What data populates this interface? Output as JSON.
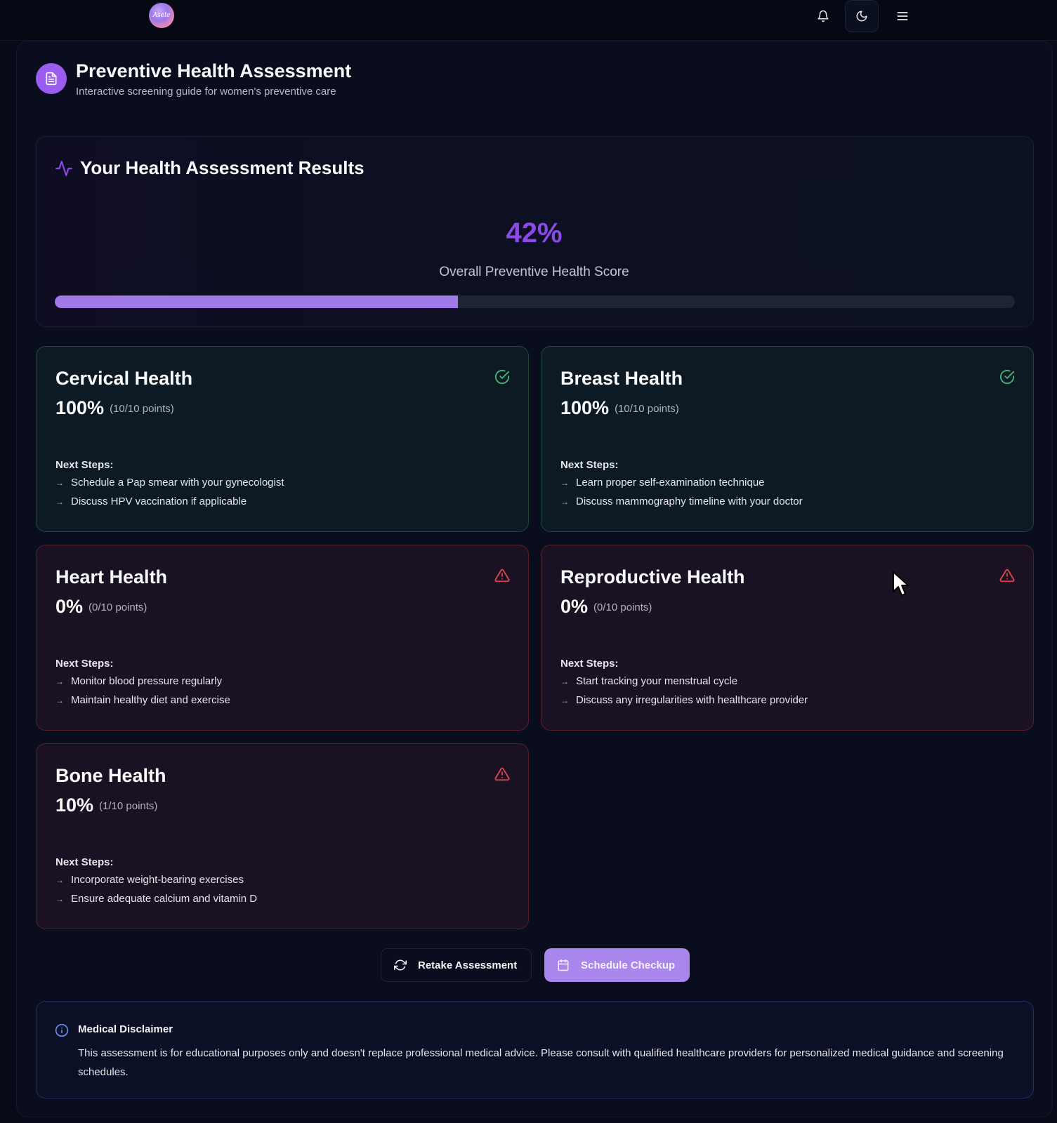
{
  "topbar": {
    "logo_text": "Asele",
    "icons": [
      "bell-icon",
      "moon-icon",
      "menu-icon"
    ]
  },
  "header": {
    "title": "Preventive Health Assessment",
    "subtitle": "Interactive screening guide for women's preventive care",
    "icon": "document-icon"
  },
  "results": {
    "title": "Your Health Assessment Results",
    "icon": "activity-icon",
    "score_text": "42%",
    "score_value": 42,
    "score_label": "Overall Preventive Health Score"
  },
  "next_steps_label": "Next Steps:",
  "categories": [
    {
      "name": "Cervical Health",
      "score": "100%",
      "points": "(10/10 points)",
      "status": "good",
      "steps": [
        "Schedule a Pap smear with your gynecologist",
        "Discuss HPV vaccination if applicable"
      ]
    },
    {
      "name": "Breast Health",
      "score": "100%",
      "points": "(10/10 points)",
      "status": "good",
      "steps": [
        "Learn proper self-examination technique",
        "Discuss mammography timeline with your doctor"
      ]
    },
    {
      "name": "Heart Health",
      "score": "0%",
      "points": "(0/10 points)",
      "status": "warning",
      "steps": [
        "Monitor blood pressure regularly",
        "Maintain healthy diet and exercise"
      ]
    },
    {
      "name": "Reproductive Health",
      "score": "0%",
      "points": "(0/10 points)",
      "status": "warning",
      "steps": [
        "Start tracking your menstrual cycle",
        "Discuss any irregularities with healthcare provider"
      ]
    },
    {
      "name": "Bone Health",
      "score": "10%",
      "points": "(1/10 points)",
      "status": "warning",
      "steps": [
        "Incorporate weight-bearing exercises",
        "Ensure adequate calcium and vitamin D"
      ]
    }
  ],
  "actions": {
    "retake_label": "Retake Assessment",
    "schedule_label": "Schedule Checkup"
  },
  "disclaimer": {
    "title": "Medical Disclaimer",
    "text": "This assessment is for educational purposes only and doesn't replace professional medical advice. Please consult with qualified healthcare providers for personalized medical guidance and screening schedules."
  },
  "colors": {
    "accent": "#8b4ae6",
    "progress": "#a07ae8",
    "good": "#3fb97a",
    "warning": "#e0454f"
  }
}
